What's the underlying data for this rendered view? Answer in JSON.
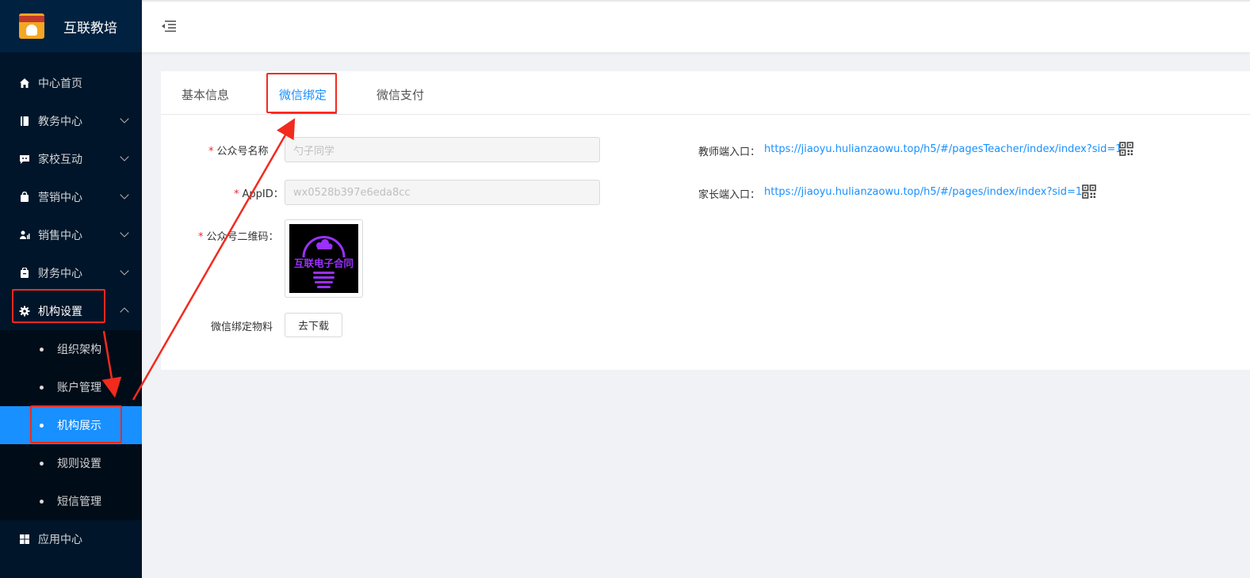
{
  "app": {
    "title": "互联教培",
    "logo_text": "互联教培"
  },
  "sidebar": {
    "items": [
      {
        "label": "中心首页",
        "icon": "home-icon"
      },
      {
        "label": "教务中心",
        "icon": "book-icon"
      },
      {
        "label": "家校互动",
        "icon": "chat-icon"
      },
      {
        "label": "营销中心",
        "icon": "bag-icon"
      },
      {
        "label": "销售中心",
        "icon": "user-chart-icon"
      },
      {
        "label": "财务中心",
        "icon": "wallet-icon"
      },
      {
        "label": "机构设置",
        "icon": "gear-icon"
      }
    ],
    "submenu": [
      {
        "label": "组织架构"
      },
      {
        "label": "账户管理"
      },
      {
        "label": "机构展示"
      },
      {
        "label": "规则设置"
      },
      {
        "label": "短信管理"
      }
    ],
    "bottom_item": {
      "label": "应用中心",
      "icon": "grid-icon"
    }
  },
  "tabs": [
    "基本信息",
    "微信绑定",
    "微信支付"
  ],
  "form": {
    "name_label": "公众号名称",
    "name_value": "勺子同学",
    "appid_label": "AppID：",
    "appid_value": "wx0528b397e6eda8cc",
    "qrcode_label": "公众号二维码：",
    "qrcode_text": "互联电子合同",
    "material_label": "微信绑定物料",
    "download_button": "去下载"
  },
  "entries": {
    "teacher_label": "教师端入口：",
    "teacher_url": "https://jiaoyu.hulianzaowu.top/h5/#/pagesTeacher/index/index?sid=1",
    "parent_label": "家长端入口：",
    "parent_url": "https://jiaoyu.hulianzaowu.top/h5/#/pages/index/index?sid=1"
  },
  "colors": {
    "accent": "#1890ff",
    "sidebar": "#001529",
    "annotation": "#f32a1e",
    "qr_purple": "#9b30ff"
  }
}
